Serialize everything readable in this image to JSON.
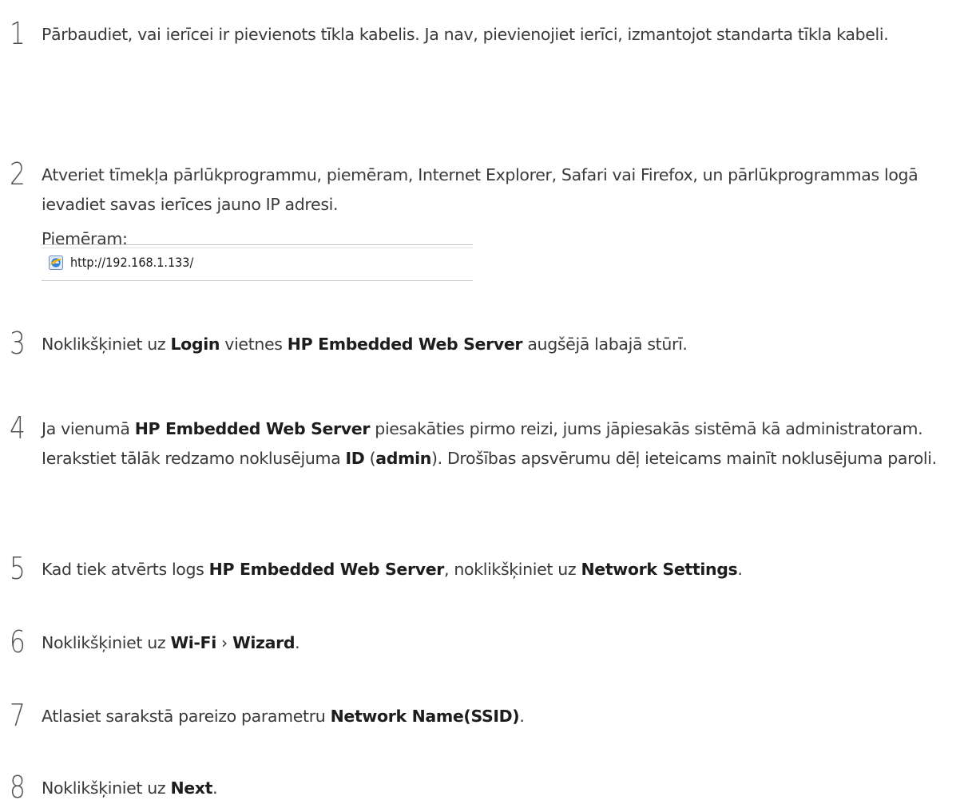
{
  "steps": [
    {
      "number": "1",
      "text": [
        {
          "t": "Pārbaudiet, vai ierīcei ir pievienots tīkla kabelis. Ja nav, pievienojiet ierīci, izmantojot standarta tīkla kabeli.",
          "b": false
        }
      ]
    },
    {
      "number": "2",
      "text": [
        {
          "t": "Atveriet tīmekļa pārlūkprogrammu, piemēram, Internet Explorer, Safari vai Firefox, un pārlūkprogrammas logā ievadiet savas ierīces jauno IP adresi.",
          "b": false
        }
      ],
      "extra": "Piemēram:"
    },
    {
      "number": "3",
      "text": [
        {
          "t": "Noklikšķiniet uz ",
          "b": false
        },
        {
          "t": "Login",
          "b": true
        },
        {
          "t": " vietnes ",
          "b": false
        },
        {
          "t": "HP Embedded Web Server",
          "b": true
        },
        {
          "t": " augšējā labajā stūrī.",
          "b": false
        }
      ]
    },
    {
      "number": "4",
      "text": [
        {
          "t": "Ja vienumā ",
          "b": false
        },
        {
          "t": "HP Embedded Web Server",
          "b": true
        },
        {
          "t": " piesakāties pirmo reizi, jums jāpiesakās sistēmā kā administratoram. Ierakstiet tālāk redzamo noklusējuma ",
          "b": false
        },
        {
          "t": "ID",
          "b": true
        },
        {
          "t": " (",
          "b": false
        },
        {
          "t": "admin",
          "b": true
        },
        {
          "t": "). Drošības apsvērumu dēļ ieteicams mainīt noklusējuma paroli.",
          "b": false
        }
      ]
    },
    {
      "number": "5",
      "text": [
        {
          "t": "Kad tiek atvērts logs ",
          "b": false
        },
        {
          "t": "HP Embedded Web Server",
          "b": true
        },
        {
          "t": ", noklikšķiniet uz ",
          "b": false
        },
        {
          "t": "Network Settings",
          "b": true
        },
        {
          "t": ".",
          "b": false
        }
      ]
    },
    {
      "number": "6",
      "text": [
        {
          "t": "Noklikšķiniet uz ",
          "b": false
        },
        {
          "t": "Wi-Fi",
          "b": true
        },
        {
          "t": " › ",
          "b": false
        },
        {
          "t": "Wizard",
          "b": true
        },
        {
          "t": ".",
          "b": false
        }
      ]
    },
    {
      "number": "7",
      "text": [
        {
          "t": "Atlasiet sarakstā pareizo parametru ",
          "b": false
        },
        {
          "t": "Network Name(SSID)",
          "b": true
        },
        {
          "t": ".",
          "b": false
        }
      ]
    },
    {
      "number": "8",
      "text": [
        {
          "t": "Noklikšķiniet uz ",
          "b": false
        },
        {
          "t": "Next",
          "b": true
        },
        {
          "t": ".",
          "b": false
        }
      ]
    }
  ],
  "example_url_bar": {
    "icon": "ie-globe-icon",
    "url": "http://192.168.1.133/"
  }
}
